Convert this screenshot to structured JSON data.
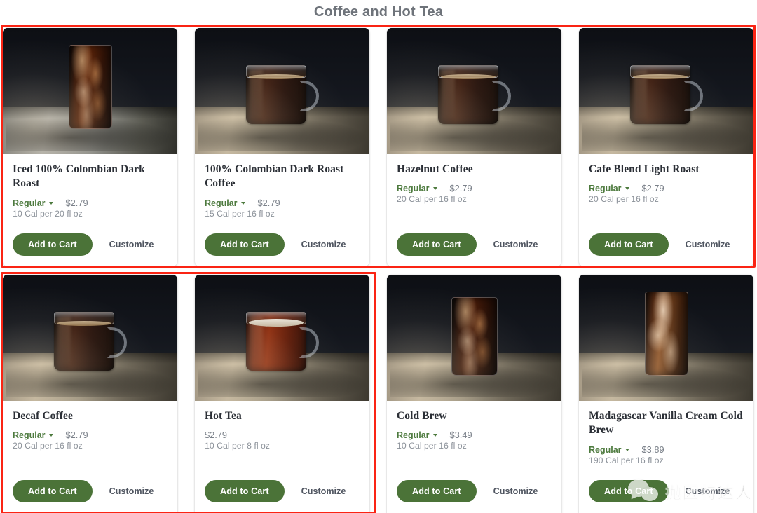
{
  "header": {
    "title": "Coffee and Hot Tea"
  },
  "labels": {
    "add_to_cart": "Add to Cart",
    "customize": "Customize",
    "caret_icon": "chevron-down-icon"
  },
  "colors": {
    "accent_green": "#4b7338",
    "size_green": "#4d7a3e",
    "annotation_red": "#fa2414",
    "title_grey": "#6e737a",
    "name_dark": "#2b2f36",
    "muted_grey": "#8b9199"
  },
  "annotations": [
    {
      "name": "red-box-row-1",
      "shape": "rectangle",
      "color": "#fa2414"
    },
    {
      "name": "red-box-row-2-left",
      "shape": "rectangle",
      "color": "#fa2414"
    }
  ],
  "watermark": {
    "icon": "wechat-icon",
    "text": "抛因特达人"
  },
  "items": [
    {
      "name": "Iced 100% Colombian Dark Roast",
      "size": "Regular",
      "has_size_selector": true,
      "price": "$2.79",
      "calories": "10 Cal per 20 fl oz",
      "photo": "iced-coffee-glass"
    },
    {
      "name": "100% Colombian Dark Roast Coffee",
      "size": "Regular",
      "has_size_selector": true,
      "price": "$2.79",
      "calories": "15 Cal per 16 fl oz",
      "photo": "hot-coffee-mug"
    },
    {
      "name": "Hazelnut Coffee",
      "size": "Regular",
      "has_size_selector": true,
      "price": "$2.79",
      "calories": "20 Cal per 16 fl oz",
      "photo": "hot-coffee-mug"
    },
    {
      "name": "Cafe Blend Light Roast",
      "size": "Regular",
      "has_size_selector": true,
      "price": "$2.79",
      "calories": "20 Cal per 16 fl oz",
      "photo": "hot-coffee-mug"
    },
    {
      "name": "Decaf Coffee",
      "size": "Regular",
      "has_size_selector": true,
      "price": "$2.79",
      "calories": "20 Cal per 16 fl oz",
      "photo": "hot-coffee-mug"
    },
    {
      "name": "Hot Tea",
      "size": "",
      "has_size_selector": false,
      "price": "$2.79",
      "calories": "10 Cal per 8 fl oz",
      "photo": "hot-tea-mug"
    },
    {
      "name": "Cold Brew",
      "size": "Regular",
      "has_size_selector": true,
      "price": "$3.49",
      "calories": "10 Cal per 16 fl oz",
      "photo": "cold-brew-glass"
    },
    {
      "name": "Madagascar Vanilla Cream Cold Brew",
      "size": "Regular",
      "has_size_selector": true,
      "price": "$3.89",
      "calories": "190 Cal per 16 fl oz",
      "photo": "vanilla-cream-cold-brew-glass"
    }
  ]
}
